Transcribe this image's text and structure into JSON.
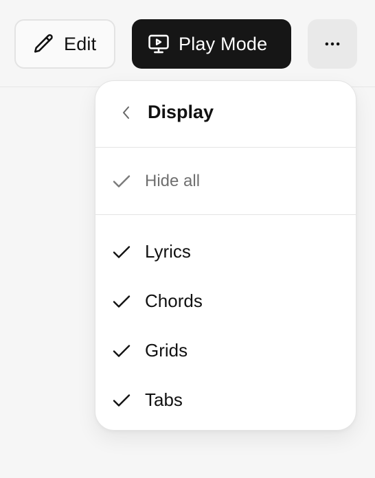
{
  "toolbar": {
    "edit_label": "Edit",
    "play_label": "Play Mode",
    "edit_icon": "pencil-icon",
    "play_icon": "monitor-play-icon",
    "more_icon": "more-dots-icon"
  },
  "menu": {
    "title": "Display",
    "back_icon": "chevron-left-icon",
    "hide_all": {
      "label": "Hide all",
      "checked": true
    },
    "items": [
      {
        "label": "Lyrics",
        "checked": true
      },
      {
        "label": "Chords",
        "checked": true
      },
      {
        "label": "Grids",
        "checked": true
      },
      {
        "label": "Tabs",
        "checked": true
      }
    ]
  },
  "colors": {
    "background": "#f6f6f6",
    "play_button": "#161616",
    "muted_text": "#6f6f6f"
  }
}
